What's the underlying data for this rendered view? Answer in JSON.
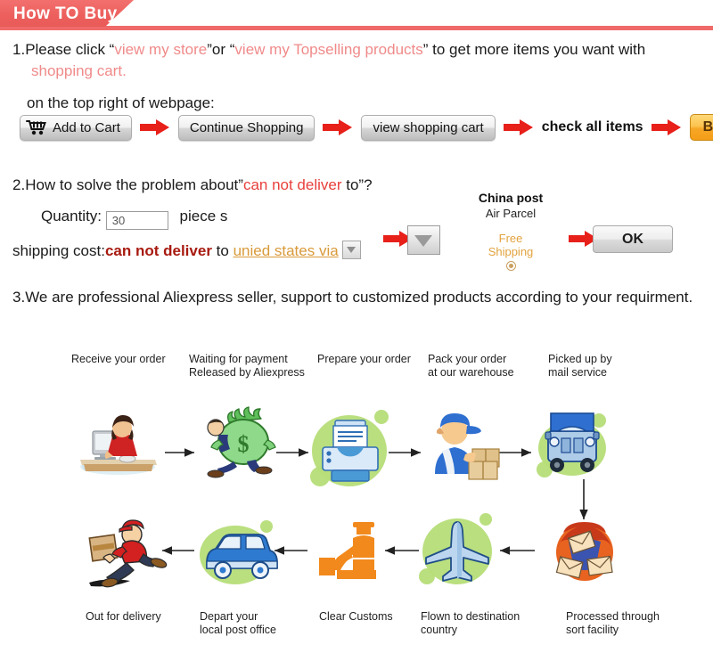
{
  "header": {
    "title": "How TO Buy",
    "accent_color": "#ec5f5d"
  },
  "colors": {
    "pink_text": "#f08a8a",
    "red_text": "#e8403c",
    "dark_red_text": "#a81a10",
    "orange_link": "#d99a3a",
    "arrow_red": "#e8201a",
    "buy_now_orange": "#f6a726",
    "flow_green": "#b6dd78"
  },
  "step1": {
    "num": "1.",
    "t1": "Please click “",
    "link1": "view my store",
    "t2": "”or “",
    "link2": "view my Topselling products",
    "t3": "” to get more items you want with",
    "link3": "shopping cart.",
    "t4": "on the top right of webpage:"
  },
  "buttons": [
    {
      "label": "Add to Cart",
      "style": "gray-cart"
    },
    {
      "label": "Continue Shopping",
      "style": "gray"
    },
    {
      "label": "view shopping cart",
      "style": "gray"
    },
    {
      "label": "check all items",
      "style": "plain"
    },
    {
      "label": "Buy now",
      "style": "orange"
    }
  ],
  "step2": {
    "num": "2.",
    "t1": "How to solve the problem about”",
    "red1": "can not deliver",
    "t2": " to”?",
    "qty_label": "Quantity:",
    "qty_value": "30",
    "qty_placeholder": "30",
    "qty_unit": "piece s",
    "ship_label": "shipping cost:",
    "ship_red": "can not deliver",
    "ship_to": " to ",
    "ship_link": "unied states via",
    "carrier_title": "China post",
    "carrier_sub": "Air Parcel",
    "free_line1": "Free",
    "free_line2": "Shipping",
    "ok_label": "OK"
  },
  "step3": {
    "num": "3.",
    "text": "We are professional Aliexpress seller, support to customized products according to your requirment."
  },
  "flow": {
    "nodes": [
      {
        "id": "receive-order",
        "label": "Receive your order",
        "icon": "person-at-computer-icon"
      },
      {
        "id": "waiting-payment",
        "label": "Waiting for payment\nReleased by Aliexpress",
        "icon": "money-bag-icon"
      },
      {
        "id": "prepare-order",
        "label": "Prepare your order",
        "icon": "printer-icon"
      },
      {
        "id": "pack-order",
        "label": "Pack your order\nat our warehouse",
        "icon": "worker-packing-icon"
      },
      {
        "id": "picked-up",
        "label": "Picked up by\nmail service",
        "icon": "truck-icon"
      },
      {
        "id": "sort-facility",
        "label": "Processed through\nsort facility",
        "icon": "mail-sorting-icon"
      },
      {
        "id": "flown-dest",
        "label": "Flown to destination\ncountry",
        "icon": "airplane-icon"
      },
      {
        "id": "clear-customs",
        "label": "Clear Customs",
        "icon": "customs-officer-icon"
      },
      {
        "id": "depart-post",
        "label": "Depart your\nlocal post office",
        "icon": "delivery-van-icon"
      },
      {
        "id": "out-delivery",
        "label": "Out for delivery",
        "icon": "courier-running-icon"
      }
    ]
  }
}
